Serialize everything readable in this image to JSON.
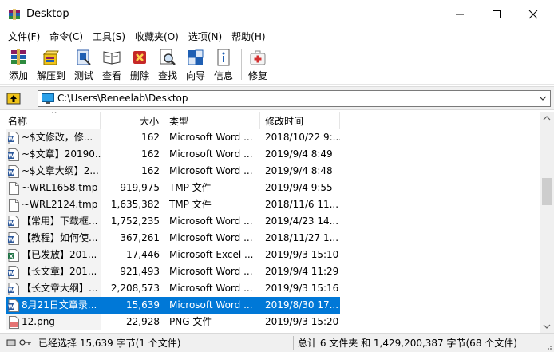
{
  "window": {
    "title": "Desktop"
  },
  "menu": [
    "文件(F)",
    "命令(C)",
    "工具(S)",
    "收藏夹(O)",
    "选项(N)",
    "帮助(H)"
  ],
  "toolbar": [
    {
      "label": "添加",
      "icon": "add-archive-icon"
    },
    {
      "label": "解压到",
      "icon": "extract-to-icon"
    },
    {
      "label": "测试",
      "icon": "test-icon"
    },
    {
      "label": "查看",
      "icon": "view-book-icon"
    },
    {
      "label": "删除",
      "icon": "delete-icon"
    },
    {
      "label": "查找",
      "icon": "find-icon"
    },
    {
      "label": "向导",
      "icon": "wizard-icon"
    },
    {
      "label": "信息",
      "icon": "info-icon"
    },
    {
      "label": "修复",
      "icon": "repair-kit-icon"
    }
  ],
  "address": {
    "path": "C:\\Users\\Reneelab\\Desktop"
  },
  "columns": {
    "name": "名称",
    "size": "大小",
    "type": "类型",
    "modified": "修改时间"
  },
  "files": [
    {
      "name": "~$文修改，修...",
      "size": "162",
      "type": "Microsoft Word ...",
      "modified": "2018/10/22 9:...",
      "icon": "word-doc-icon",
      "selected": false
    },
    {
      "name": "~$文章】20190...",
      "size": "162",
      "type": "Microsoft Word ...",
      "modified": "2019/9/4 8:49",
      "icon": "word-doc-icon",
      "selected": false
    },
    {
      "name": "~$文章大纲】2...",
      "size": "162",
      "type": "Microsoft Word ...",
      "modified": "2019/9/4 8:48",
      "icon": "word-doc-icon",
      "selected": false
    },
    {
      "name": "~WRL1658.tmp",
      "size": "919,975",
      "type": "TMP 文件",
      "modified": "2019/9/4 9:55",
      "icon": "blank-file-icon",
      "selected": false
    },
    {
      "name": "~WRL2124.tmp",
      "size": "1,635,382",
      "type": "TMP 文件",
      "modified": "2018/11/6 11...",
      "icon": "blank-file-icon",
      "selected": false
    },
    {
      "name": "【常用】下载框...",
      "size": "1,752,235",
      "type": "Microsoft Word ...",
      "modified": "2019/4/23 14...",
      "icon": "word-doc-icon",
      "selected": false
    },
    {
      "name": "【教程】如何使...",
      "size": "367,261",
      "type": "Microsoft Word ...",
      "modified": "2018/11/27 1...",
      "icon": "word-doc-icon",
      "selected": false
    },
    {
      "name": "【已发放】201...",
      "size": "17,446",
      "type": "Microsoft Excel ...",
      "modified": "2019/9/3 15:10",
      "icon": "excel-doc-icon",
      "selected": false
    },
    {
      "name": "【长文章】201...",
      "size": "921,493",
      "type": "Microsoft Word ...",
      "modified": "2019/9/4 11:29",
      "icon": "word-doc-icon",
      "selected": false
    },
    {
      "name": "【长文章大纲】...",
      "size": "2,208,573",
      "type": "Microsoft Word ...",
      "modified": "2019/9/3 15:16",
      "icon": "word-doc-icon",
      "selected": false
    },
    {
      "name": "8月21日文章录...",
      "size": "15,639",
      "type": "Microsoft Word ...",
      "modified": "2019/8/30 17...",
      "icon": "word-doc-icon",
      "selected": true
    },
    {
      "name": "12.png",
      "size": "22,928",
      "type": "PNG 文件",
      "modified": "2019/9/3 15:20",
      "icon": "png-image-icon",
      "selected": false
    }
  ],
  "status": {
    "left": "已经选择 15,639 字节(1 个文件)",
    "right": "总计 6 文件夹 和 1,429,200,387 字节(68 个文件)"
  },
  "colors": {
    "selection": "#0078d7",
    "word_blue": "#2b579a",
    "excel_green": "#217346"
  }
}
